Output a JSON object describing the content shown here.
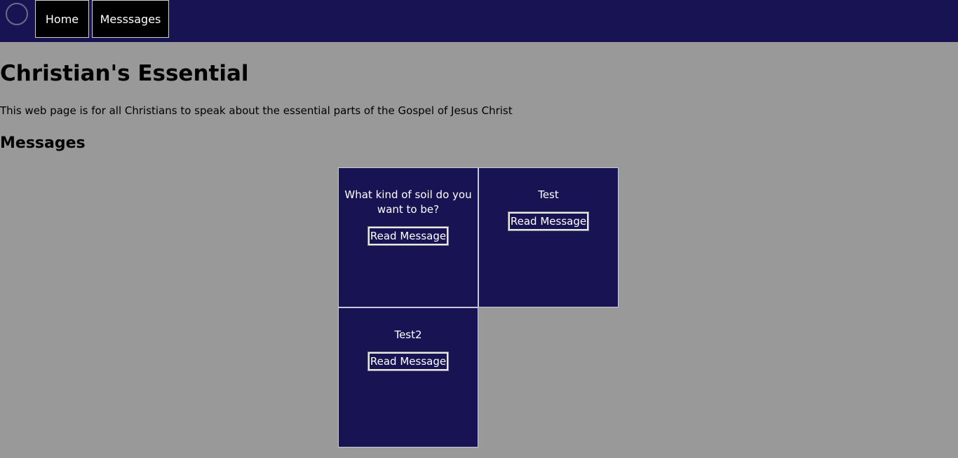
{
  "nav": {
    "home_label": "Home",
    "messages_label": "Messsages"
  },
  "header": {
    "title": "Christian's Essential",
    "intro": "This web page is for all Christians to speak about the essential parts of the Gospel of Jesus Christ",
    "section_title": "Messages"
  },
  "cards": [
    {
      "title": "What kind of soil do you want to be?",
      "button_label": "Read Message"
    },
    {
      "title": "Test",
      "button_label": "Read Message"
    },
    {
      "title": "Test2",
      "button_label": "Read Message"
    }
  ],
  "colors": {
    "navbar_bg": "#181352",
    "page_bg": "#999999",
    "card_bg": "#181352"
  }
}
